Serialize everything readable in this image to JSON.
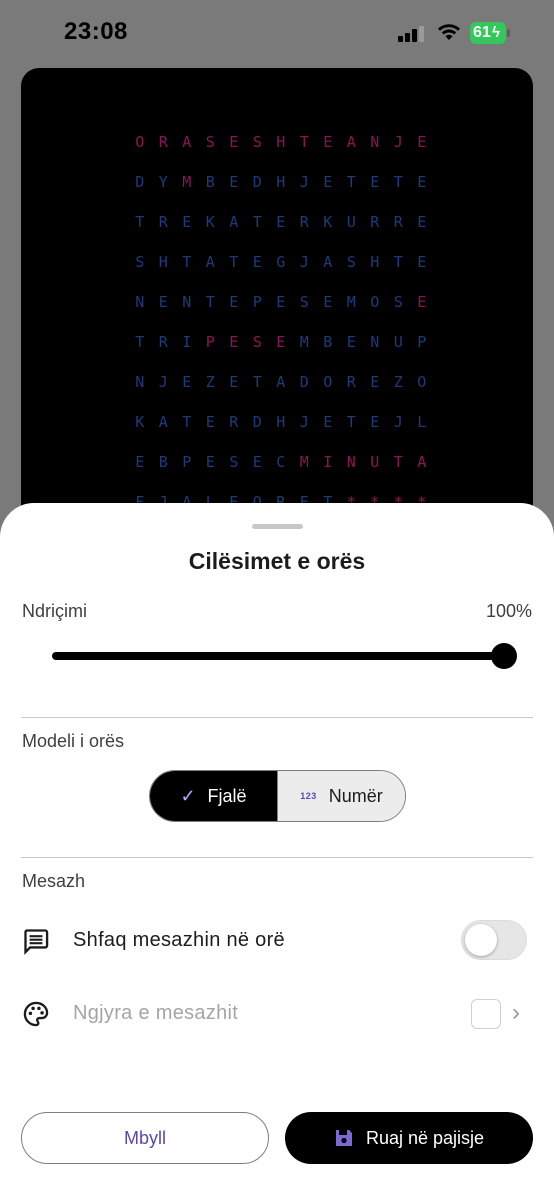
{
  "status_bar": {
    "time": "23:08",
    "battery": "61",
    "icons": [
      "signal-icon",
      "wifi-icon",
      "battery-charging-icon"
    ]
  },
  "clock_preview": {
    "active_color": "#8b1456",
    "inactive_color": "#1d3a7a",
    "rows": [
      {
        "letters": [
          "O",
          "R",
          "A",
          "S",
          "E",
          "S",
          "H",
          "T",
          "E",
          "A",
          "N",
          "J",
          "E"
        ],
        "lit": [
          0,
          1,
          2,
          3,
          4,
          5,
          6,
          7,
          8,
          9,
          10,
          11,
          12
        ]
      },
      {
        "letters": [
          "D",
          "Y",
          "M",
          "B",
          "E",
          "D",
          "H",
          "J",
          "E",
          "T",
          "E",
          "T",
          "E"
        ],
        "lit": [
          2
        ]
      },
      {
        "letters": [
          "T",
          "R",
          "E",
          "K",
          "A",
          "T",
          "E",
          "R",
          "K",
          "U",
          "R",
          "R",
          "E"
        ],
        "lit": []
      },
      {
        "letters": [
          "S",
          "H",
          "T",
          "A",
          "T",
          "E",
          "G",
          "J",
          "A",
          "S",
          "H",
          "T",
          "E"
        ],
        "lit": []
      },
      {
        "letters": [
          "N",
          "E",
          "N",
          "T",
          "E",
          "P",
          "E",
          "S",
          "E",
          "M",
          "O",
          "S",
          "E"
        ],
        "lit": [
          12
        ]
      },
      {
        "letters": [
          "T",
          "R",
          "I",
          "P",
          "E",
          "S",
          "E",
          "M",
          "B",
          "E",
          "N",
          "U",
          "P"
        ],
        "lit": [
          3,
          4,
          5,
          6
        ]
      },
      {
        "letters": [
          "N",
          "J",
          "E",
          "Z",
          "E",
          "T",
          "A",
          "D",
          "O",
          "R",
          "E",
          "Z",
          "O"
        ],
        "lit": []
      },
      {
        "letters": [
          "K",
          "A",
          "T",
          "E",
          "R",
          "D",
          "H",
          "J",
          "E",
          "T",
          "E",
          "J",
          "L"
        ],
        "lit": []
      },
      {
        "letters": [
          "E",
          "B",
          "P",
          "E",
          "S",
          "E",
          "C",
          "M",
          "I",
          "N",
          "U",
          "T",
          "A"
        ],
        "lit": [
          7,
          8,
          9,
          10,
          11,
          12
        ]
      },
      {
        "letters": [
          "F",
          "J",
          "A",
          "L",
          "E",
          "O",
          "R",
          "E",
          "T",
          "*",
          "*",
          "*",
          "*"
        ],
        "lit": [
          9,
          10,
          11,
          12
        ]
      }
    ]
  },
  "sheet": {
    "title": "Cilësimet e orës",
    "brightness": {
      "label": "Ndriçimi",
      "value_text": "100%",
      "value": 1.0
    },
    "model": {
      "label": "Modeli i orës",
      "options": [
        {
          "label": "Fjalë",
          "icon": "check-icon",
          "selected": true
        },
        {
          "label": "Numër",
          "icon": "numbers-icon",
          "icon_text": "123",
          "selected": false
        }
      ]
    },
    "message": {
      "label": "Mesazh",
      "show_label": "Shfaq mesazhin në orë",
      "show_enabled": false,
      "color_label": "Ngjyra e mesazhit",
      "color_value": "#ffffff"
    },
    "buttons": {
      "close": "Mbyll",
      "save": "Ruaj në pajisje"
    },
    "accent_color": "#5b46b3"
  }
}
